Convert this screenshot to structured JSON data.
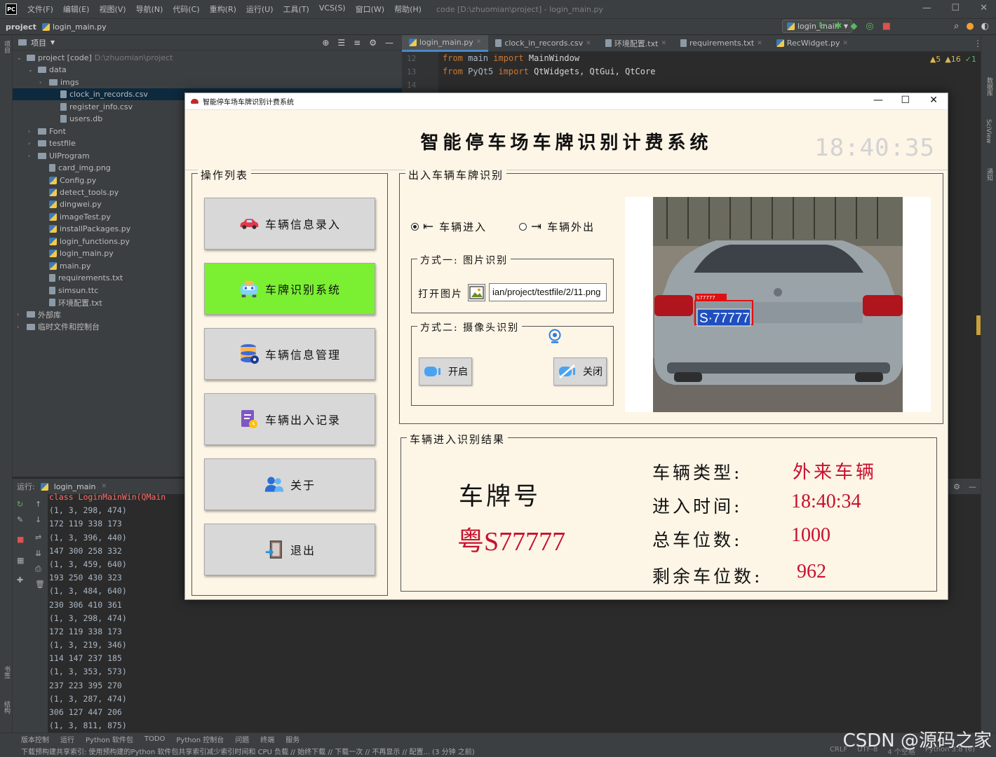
{
  "ide": {
    "menu": [
      "文件(F)",
      "编辑(E)",
      "视图(V)",
      "导航(N)",
      "代码(C)",
      "重构(R)",
      "运行(U)",
      "工具(T)",
      "VCS(S)",
      "窗口(W)",
      "帮助(H)"
    ],
    "window_title": "code [D:\\zhuomian\\project] - login_main.py",
    "breadcrumb_project": "project",
    "breadcrumb_file": "login_main.py",
    "run_config": "login_main",
    "project_panel_title": "项目",
    "tree": [
      {
        "label": "project [code]",
        "extra": "D:\\zhuomian\\project",
        "indent": 0,
        "type": "dir",
        "arrow": "v"
      },
      {
        "label": "data",
        "indent": 1,
        "type": "dir",
        "arrow": "v"
      },
      {
        "label": "imgs",
        "indent": 2,
        "type": "dir",
        "arrow": ">"
      },
      {
        "label": "clock_in_records.csv",
        "indent": 3,
        "type": "file",
        "selected": true
      },
      {
        "label": "register_info.csv",
        "indent": 3,
        "type": "file"
      },
      {
        "label": "users.db",
        "indent": 3,
        "type": "file"
      },
      {
        "label": "Font",
        "indent": 1,
        "type": "dir",
        "arrow": ">"
      },
      {
        "label": "testfile",
        "indent": 1,
        "type": "dir",
        "arrow": ">"
      },
      {
        "label": "UIProgram",
        "indent": 1,
        "type": "dir",
        "arrow": ">"
      },
      {
        "label": "card_img.png",
        "indent": 2,
        "type": "file"
      },
      {
        "label": "Config.py",
        "indent": 2,
        "type": "py"
      },
      {
        "label": "detect_tools.py",
        "indent": 2,
        "type": "py"
      },
      {
        "label": "dingwei.py",
        "indent": 2,
        "type": "py"
      },
      {
        "label": "imageTest.py",
        "indent": 2,
        "type": "py"
      },
      {
        "label": "installPackages.py",
        "indent": 2,
        "type": "py"
      },
      {
        "label": "login_functions.py",
        "indent": 2,
        "type": "py"
      },
      {
        "label": "login_main.py",
        "indent": 2,
        "type": "py"
      },
      {
        "label": "main.py",
        "indent": 2,
        "type": "py"
      },
      {
        "label": "requirements.txt",
        "indent": 2,
        "type": "file"
      },
      {
        "label": "simsun.ttc",
        "indent": 2,
        "type": "file"
      },
      {
        "label": "环境配置.txt",
        "indent": 2,
        "type": "file"
      },
      {
        "label": "外部库",
        "indent": 0,
        "type": "dir",
        "arrow": ">"
      },
      {
        "label": "临时文件和控制台",
        "indent": 0,
        "type": "dir",
        "arrow": ">"
      }
    ],
    "editor_tabs": [
      {
        "label": "login_main.py",
        "active": true
      },
      {
        "label": "clock_in_records.csv"
      },
      {
        "label": "环境配置.txt"
      },
      {
        "label": "requirements.txt"
      },
      {
        "label": "RecWidget.py"
      }
    ],
    "code_lines": [
      {
        "num": "12",
        "kw": "from",
        "mod": " main ",
        "kw2": "import",
        "rest": " MainWindow"
      },
      {
        "num": "13",
        "kw": "from",
        "mod": " PyQt5 ",
        "kw2": "import",
        "rest": " QtWidgets, QtGui, QtCore"
      },
      {
        "num": "14",
        "kw": "",
        "mod": "",
        "kw2": "",
        "rest": ""
      }
    ],
    "inspections": {
      "warn": "▲5",
      "weak": "▲16",
      "ok": "✓1"
    },
    "run_label": "运行:",
    "run_tab": "login_main",
    "console_lines": [
      "class LoginMainWin(QMain",
      "(1, 3, 298, 474)",
      "172 119 338 173",
      "(1, 3, 396, 440)",
      "147 300 258 332",
      "(1, 3, 459, 640)",
      "193 250 430 323",
      "(1, 3, 484, 640)",
      "230 306 410 361",
      "(1, 3, 298, 474)",
      "172 119 338 173",
      "(1, 3, 219, 346)",
      "114 147 237 185",
      "(1, 3, 353, 573)",
      "237 223 395 270",
      "(1, 3, 287, 474)",
      "306 127 447 206",
      "(1, 3, 811, 875)"
    ],
    "bottom_tabs": [
      "版本控制",
      "运行",
      "Python 软件包",
      "TODO",
      "Python 控制台",
      "问题",
      "终端",
      "服务"
    ],
    "status_message": "下载预构建共享索引: 使用预构建的Python 软件包共享索引减少索引时间和 CPU 负载 // 始终下载 // 下载一次 // 不再显示 // 配置... (3 分钟 之前)",
    "status_right": [
      "CRLF",
      "UTF-8",
      "4 个空格",
      "Python 3.8 (6)"
    ],
    "watermark": "CSDN @源码之家",
    "left_tool_labels": [
      "项目",
      "书签",
      "结构"
    ],
    "right_tool_labels": [
      "数据库",
      "SciView",
      "通知"
    ]
  },
  "app": {
    "window_title": "智能停车场车牌识别计费系统",
    "main_title": "智能停车场车牌识别计费系统",
    "clock": "18:40:35",
    "op_group_title": "操作列表",
    "op_buttons": [
      {
        "label": "车辆信息录入",
        "icon": "car-icon",
        "active": false
      },
      {
        "label": "车牌识别系统",
        "icon": "robot-car-icon",
        "active": true
      },
      {
        "label": "车辆信息管理",
        "icon": "database-icon",
        "active": false
      },
      {
        "label": "车辆出入记录",
        "icon": "record-doc-icon",
        "active": false
      },
      {
        "label": "关于",
        "icon": "users-icon",
        "active": false
      },
      {
        "label": "退出",
        "icon": "exit-door-icon",
        "active": false
      }
    ],
    "recog_group_title": "出入车辆车牌识别",
    "radio_enter": "车辆进入",
    "radio_exit": "车辆外出",
    "method1_title": "方式一: 图片识别",
    "open_image_label": "打开图片",
    "image_path": "ian/project/testfile/2/11.png",
    "method2_title": "方式二: 摄像头识别",
    "camera_open_label": "开启",
    "camera_close_label": "关闭",
    "plate_overlay": "S·77777",
    "plate_overlay_small": "S77777",
    "result_group_title": "车辆进入识别结果",
    "plate_heading": "车牌号",
    "plate_number": "粤S77777",
    "vehicle_type_label": "车辆类型:",
    "vehicle_type": "外来车辆",
    "entry_time_label": "进入时间:",
    "entry_time": "18:40:34",
    "total_spaces_label": "总车位数:",
    "total_spaces": "1000",
    "remaining_spaces_label": "剩余车位数:",
    "remaining_spaces": "962",
    "colors": {
      "active_button": "#7bf032",
      "result_red": "#c8102e",
      "background": "#fdf5e6"
    }
  }
}
